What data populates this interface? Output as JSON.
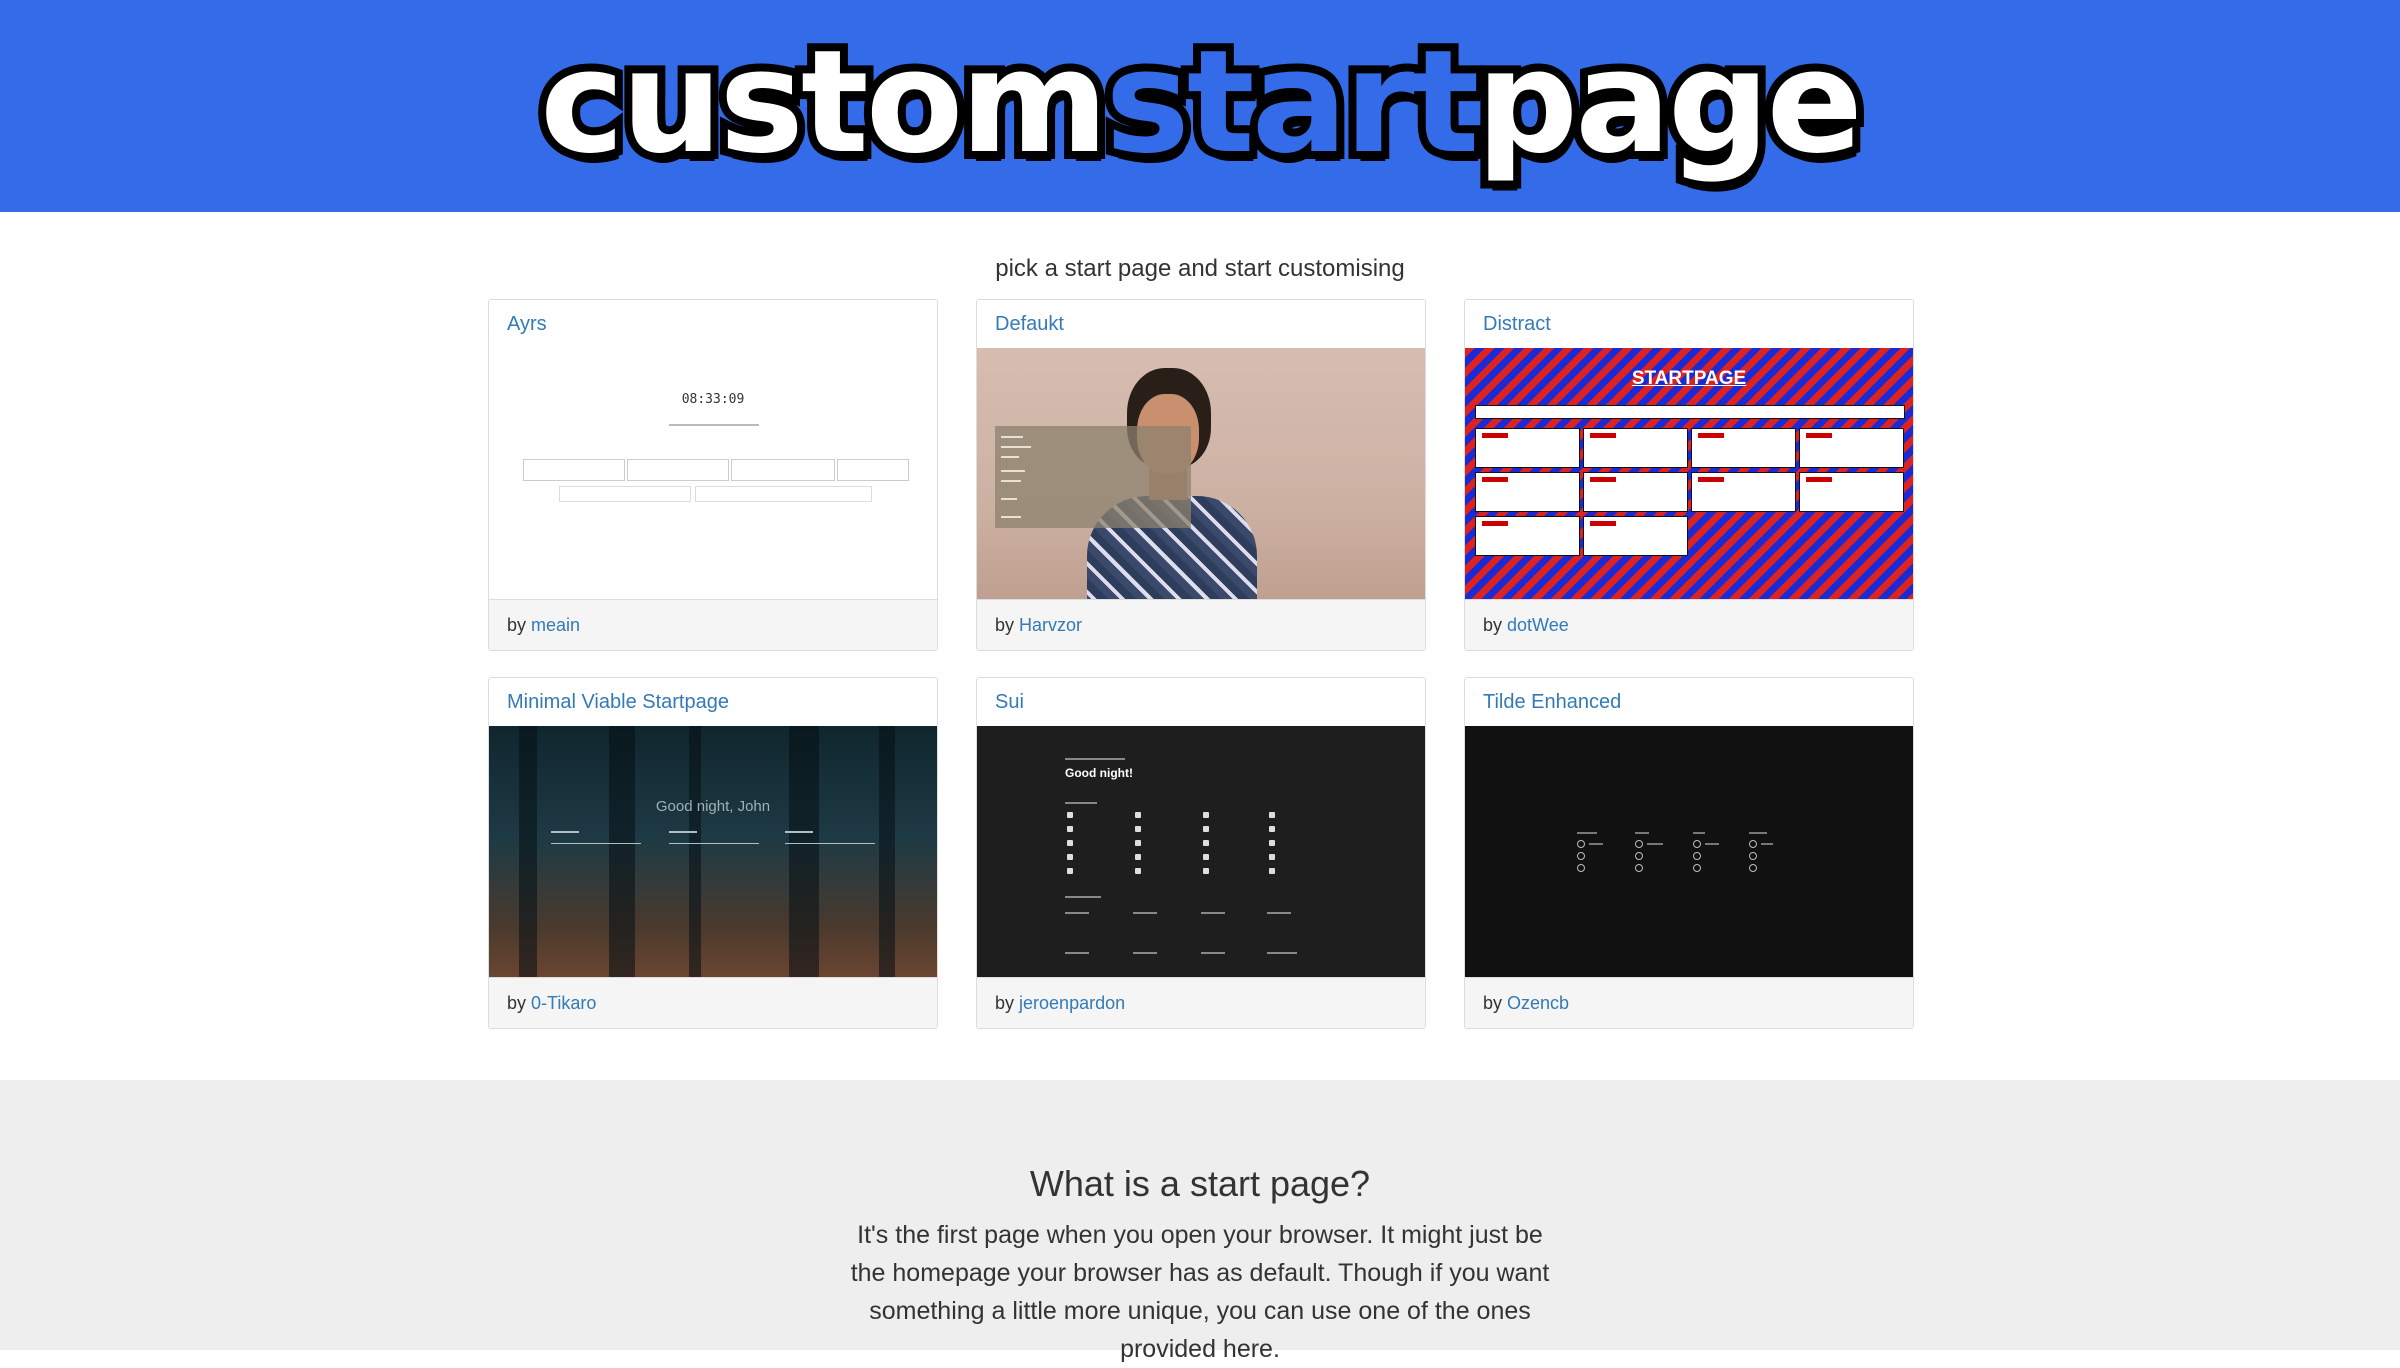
{
  "brand": {
    "part1": "custom",
    "part2": "start",
    "part3": "page",
    "bg_color": "#346be8"
  },
  "tagline": "pick a start page and start customising",
  "cards": [
    {
      "title": "Ayrs",
      "by": "by",
      "author": "meain",
      "clock": "08:33:09"
    },
    {
      "title": "Defaukt",
      "by": "by",
      "author": "Harvzor"
    },
    {
      "title": "Distract",
      "by": "by",
      "author": "dotWee",
      "heading": "STARTPAGE"
    },
    {
      "title": "Minimal Viable Startpage",
      "by": "by",
      "author": "0-Tikaro",
      "greeting": "Good night, John"
    },
    {
      "title": "Sui",
      "by": "by",
      "author": "jeroenpardon",
      "greeting": "Good night!"
    },
    {
      "title": "Tilde Enhanced",
      "by": "by",
      "author": "Ozencb"
    }
  ],
  "info": {
    "heading": "What is a start page?",
    "body": "It's the first page when you open your browser. It might just be the homepage your browser has as default. Though if you want something a little more unique, you can use one of the ones provided here."
  },
  "colors": {
    "link": "#337ab7",
    "footer_bg": "#f5f5f5",
    "info_bg": "#eeeeee"
  }
}
